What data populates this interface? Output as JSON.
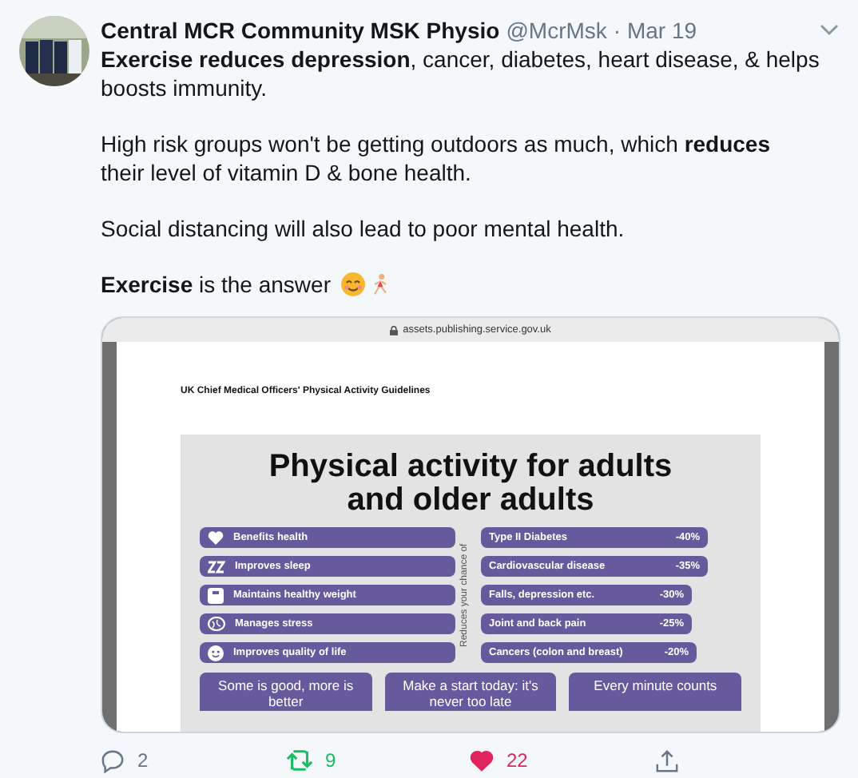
{
  "author": {
    "name": "Central MCR Community MSK Physio",
    "handle": "@McrMsk",
    "date": "· Mar 19"
  },
  "paragraphs": [
    "**Exercise reduces depression**, cancer, diabetes, heart disease, & helps boosts immunity.",
    "High risk groups won't be getting outdoors as much, which **reduces** their level of vitamin D & bone health.",
    "Social distancing will also lead to poor mental health.",
    "**Exercise** is the answer"
  ],
  "embed": {
    "url": "assets.publishing.service.gov.uk",
    "doc_heading": "UK Chief Medical Officers' Physical Activity Guidelines",
    "title": [
      "Physical activity for adults",
      "and older adults"
    ],
    "benefits": [
      {
        "kind": "heart",
        "text": "Benefits health"
      },
      {
        "kind": "sleep",
        "text": "Improves sleep"
      },
      {
        "kind": "scale",
        "text": "Maintains healthy weight"
      },
      {
        "kind": "brain",
        "text": "Manages stress"
      },
      {
        "kind": "smile",
        "text": "Improves quality of life"
      }
    ],
    "side_label": "Reduces your chance of",
    "risks": [
      {
        "text": "Type II Diabetes",
        "value": "-40%"
      },
      {
        "text": "Cardiovascular disease",
        "value": "-35%"
      },
      {
        "text": "Falls, depression etc.",
        "value": "-30%"
      },
      {
        "text": "Joint and back pain",
        "value": "-25%"
      },
      {
        "text": "Cancers (colon and breast)",
        "value": "-20%"
      }
    ],
    "tips": [
      "Some is good, more is better",
      "Make a start today: it's never too late",
      "Every minute counts"
    ]
  },
  "actions": {
    "replies": "2",
    "retweets": "9",
    "likes": "22",
    "retweeted": true,
    "liked": true
  }
}
